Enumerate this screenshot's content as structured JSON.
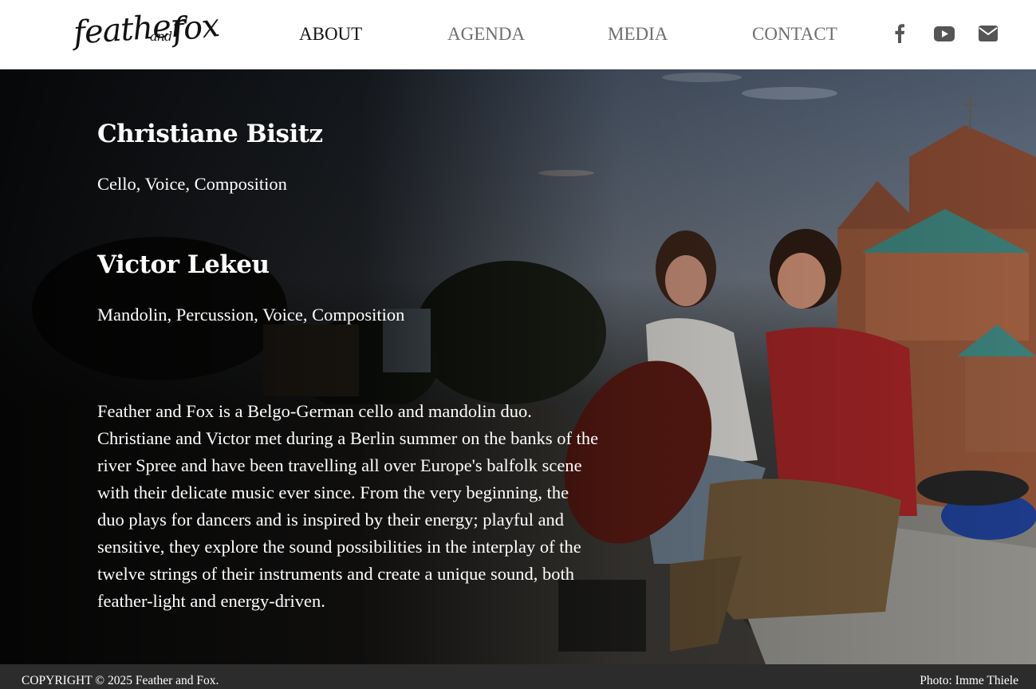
{
  "brand": {
    "logo_feather": "feather",
    "logo_and": "and",
    "logo_fox": "fox"
  },
  "nav": {
    "items": [
      {
        "label": "ABOUT",
        "active": true
      },
      {
        "label": "AGENDA",
        "active": false
      },
      {
        "label": "MEDIA",
        "active": false
      },
      {
        "label": "CONTACT",
        "active": false
      }
    ]
  },
  "social": [
    {
      "icon": "facebook-icon"
    },
    {
      "icon": "youtube-icon"
    },
    {
      "icon": "envelope-icon"
    }
  ],
  "members": [
    {
      "name": "Christiane Bisitz",
      "role": "Cello, Voice, Composition"
    },
    {
      "name": "Victor Lekeu",
      "role": "Mandolin, Percussion, Voice, Composition"
    }
  ],
  "about": {
    "text": "Feather and Fox is a Belgo-German cello and mandolin duo. Christiane and Victor met during a Berlin summer on the banks of the river Spree and have been travelling all over Europe's balfolk scene with their delicate music ever since. From the very beginning, the duo plays for dancers and is inspired by their energy; playful and sensitive, they explore the sound possibilities in the interplay of the twelve strings of their instruments and create a unique sound, both feather-light and energy-driven."
  },
  "footer": {
    "copyright": "COPYRIGHT © 2025 Feather and Fox.",
    "photo_credit": "Photo: Imme Thiele"
  },
  "colors": {
    "header_bg": "#ffffff",
    "nav_active": "#111111",
    "nav_inactive": "#6e6e6e",
    "social_icon": "#555555",
    "footer_bg": "#2c2c2c"
  }
}
